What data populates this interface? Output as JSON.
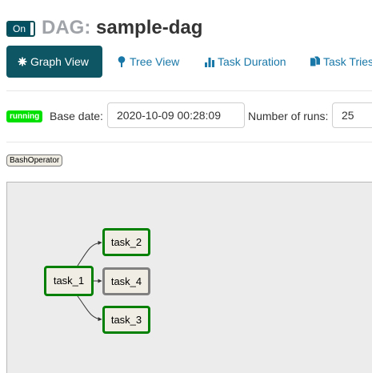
{
  "header": {
    "toggle_label": "On",
    "title_prefix": "DAG:",
    "dag_name": "sample-dag"
  },
  "tabs": [
    {
      "label": "Graph View",
      "icon": "asterisk-icon",
      "active": true
    },
    {
      "label": "Tree View",
      "icon": "tree-icon",
      "active": false
    },
    {
      "label": "Task Duration",
      "icon": "bar-chart-icon",
      "active": false
    },
    {
      "label": "Task Tries",
      "icon": "duplicate-icon",
      "active": false
    }
  ],
  "controls": {
    "state_badge": "running",
    "base_date_label": "Base date:",
    "base_date_value": "2020-10-09 00:28:09",
    "num_runs_label": "Number of runs:",
    "num_runs_value": "25"
  },
  "legend": {
    "operators": [
      "BashOperator"
    ]
  },
  "graph": {
    "nodes": [
      {
        "id": "task_1",
        "label": "task_1",
        "status": "success"
      },
      {
        "id": "task_2",
        "label": "task_2",
        "status": "success"
      },
      {
        "id": "task_4",
        "label": "task_4",
        "status": "no_status"
      },
      {
        "id": "task_3",
        "label": "task_3",
        "status": "success"
      }
    ],
    "edges": [
      {
        "from": "task_1",
        "to": "task_2"
      },
      {
        "from": "task_1",
        "to": "task_4"
      },
      {
        "from": "task_1",
        "to": "task_3"
      }
    ]
  },
  "colors": {
    "accent": "#0e5663",
    "link": "#1a78a8",
    "running": "#00e000",
    "success_border": "#008000",
    "no_status_border": "#808080",
    "node_fill": "#f0ede4"
  }
}
